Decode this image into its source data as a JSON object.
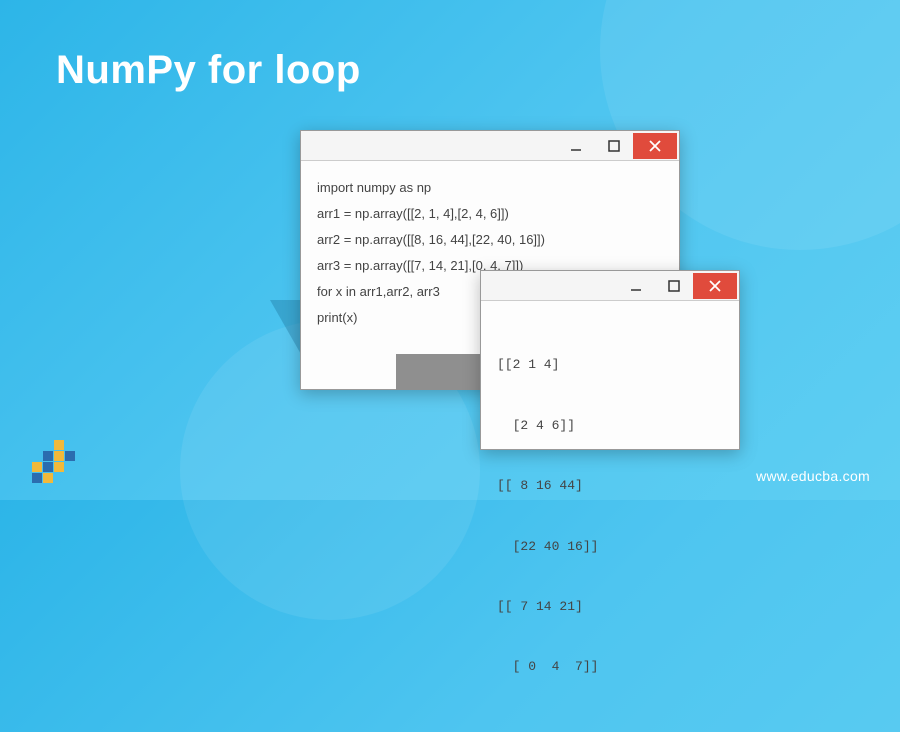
{
  "title": "NumPy for loop",
  "url": "www.educba.com",
  "window_code": {
    "lines": [
      "import numpy as np",
      "arr1 = np.array([[2, 1, 4],[2, 4, 6]])",
      "arr2 = np.array([[8, 16, 44],[22, 40, 16]])",
      "arr3 = np.array([[7, 14, 21],[0, 4, 7]])",
      "for x in arr1,arr2, arr3",
      "print(x)"
    ]
  },
  "window_output": {
    "lines": [
      "[[2 1 4]",
      "  [2 4 6]]",
      "[[ 8 16 44]",
      "  [22 40 16]]",
      "[[ 7 14 21]",
      "  [ 0  4  7]]"
    ]
  },
  "colors": {
    "close_btn": "#e04b3c",
    "logo_blue": "#2b6daf",
    "logo_yellow": "#f1b93b"
  }
}
